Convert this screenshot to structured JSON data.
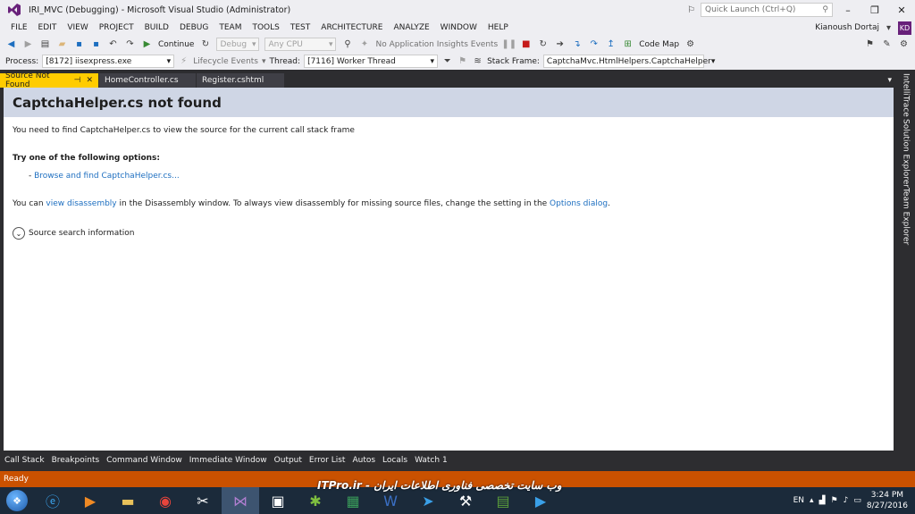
{
  "window": {
    "title": "IRI_MVC (Debugging) - Microsoft Visual Studio (Administrator)",
    "quick_launch_placeholder": "Quick Launch (Ctrl+Q)",
    "user_name": "Kianoush Dortaj",
    "user_initials": "KD"
  },
  "menu": [
    "FILE",
    "EDIT",
    "VIEW",
    "PROJECT",
    "BUILD",
    "DEBUG",
    "TEAM",
    "TOOLS",
    "TEST",
    "ARCHITECTURE",
    "ANALYZE",
    "WINDOW",
    "HELP"
  ],
  "toolbar": {
    "continue_label": "Continue",
    "config_value": "Debug",
    "platform_value": "Any CPU",
    "insights_label": "No Application Insights Events",
    "code_map_label": "Code Map"
  },
  "debug_location": {
    "process_label": "Process:",
    "process_value": "[8172] iisexpress.exe",
    "lifecycle_label": "Lifecycle Events",
    "thread_label": "Thread:",
    "thread_value": "[7116] Worker Thread",
    "stack_frame_label": "Stack Frame:",
    "stack_frame_value": "CaptchaMvc.HtmlHelpers.CaptchaHelper"
  },
  "tabs": [
    {
      "label": "Source Not Found"
    },
    {
      "label": "HomeController.cs"
    },
    {
      "label": "Register.cshtml"
    }
  ],
  "doc": {
    "heading": "CaptchaHelper.cs not found",
    "intro": "You need to find CaptchaHelper.cs to view the source for the current call stack frame",
    "options_title": "Try one of the following options:",
    "option_link": "Browse and find CaptchaHelper.cs...",
    "disasm_prefix": "You can ",
    "disasm_link": "view disassembly",
    "disasm_middle": " in the Disassembly window. To always view disassembly for missing source files, change the setting in the ",
    "options_dialog_link": "Options dialog",
    "disasm_suffix": ".",
    "source_search_label": "Source search information"
  },
  "side_tabs": [
    "IntelliTrace",
    "Solution Explorer",
    "Team Explorer"
  ],
  "bottom_tabs": [
    "Call Stack",
    "Breakpoints",
    "Command Window",
    "Immediate Window",
    "Output",
    "Error List",
    "Autos",
    "Locals",
    "Watch 1"
  ],
  "status_text": "Ready",
  "watermark": "ITPro.ir - وب سایت تخصصی فناوری اطلاعات ایران",
  "tray": {
    "language": "EN",
    "time": "3:24 PM",
    "date": "8/27/2016"
  },
  "colors": {
    "vs_purple": "#68217a",
    "active_tab": "#ffcc00",
    "status_bar": "#ca5100",
    "link": "#1e6fc0"
  }
}
